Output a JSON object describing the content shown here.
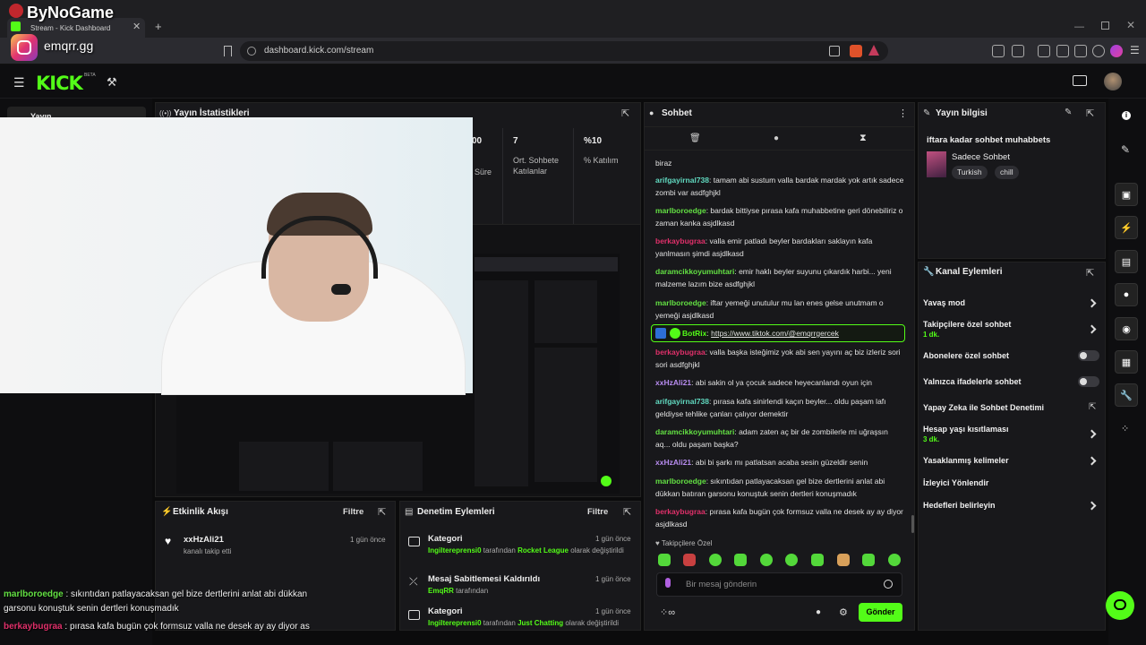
{
  "overlay": {
    "brand": "ByNoGame",
    "instagram": "emqrr.gg"
  },
  "browser": {
    "tab_title": "Stream - Kick Dashboard",
    "url": "dashboard.kick.com/stream"
  },
  "kick": {
    "logo": "KICK",
    "beta": "BETA"
  },
  "sidebar": {
    "label": "Yayın"
  },
  "stats": {
    "title": "Yayın İstatistikleri",
    "items": [
      {
        "value": "00",
        "label": "Süre"
      },
      {
        "value": "7",
        "label": "Ort. Sohbete Katılanlar"
      },
      {
        "value": "%10",
        "label": "% Katılım"
      }
    ]
  },
  "chat": {
    "title": "Sohbet",
    "messages": [
      {
        "user": "",
        "text": "biraz",
        "color": "#e2e2e2"
      },
      {
        "user": "arifgayirnal738",
        "text": "tamam abi sustum valla bardak mardak yok artık sadece zombi var asdfghjkl",
        "color": "#61d9c0"
      },
      {
        "user": "marlboroedge",
        "text": "bardak bittiyse pırasa kafa muhabbetine geri dönebiliriz o zaman kanka asjdlkasd",
        "color": "#63e043"
      },
      {
        "user": "berkaybugraa",
        "text": "valla emir patladı beyler bardakları saklayın kafa yanlmasın şimdi asjdlkasd",
        "color": "#e0306a"
      },
      {
        "user": "daramcikkoyumuhtari",
        "text": "emir haklı beyler suyunu çıkardık harbi... yeni malzeme lazım bize asdfghjkl",
        "color": "#63e043"
      },
      {
        "user": "marlboroedge",
        "text": "iftar yemeği unutulur mu lan enes gelse unutmam o yemeği asjdlkasd",
        "color": "#63e043"
      },
      {
        "user": "BotRix",
        "text": "https://www.tiktok.com/@emqrrgercek",
        "color": "#53fc18"
      },
      {
        "user": "berkaybugraa",
        "text": "valla başka isteğimiz yok abi sen yayını aç biz izleriz sori sori asdfghjkl",
        "color": "#e0306a"
      },
      {
        "user": "xxHzAli21",
        "text": "abi sakin ol ya çocuk sadece heyecanlandı oyun için",
        "color": "#b88cf0"
      },
      {
        "user": "arifgayirnal738",
        "text": "pırasa kafa sinirlendi kaçın beyler... oldu paşam lafı geldiyse tehlike çanları çalıyor demektir",
        "color": "#61d9c0"
      },
      {
        "user": "daramcikkoyumuhtari",
        "text": "adam zaten aç bir de zombilerle mi uğraşsın aq... oldu paşam başka?",
        "color": "#63e043"
      },
      {
        "user": "xxHzAli21",
        "text": "abi bi şarkı mı patlatsan acaba sesin güzeldir senin",
        "color": "#b88cf0"
      },
      {
        "user": "marlboroedge",
        "text": "sıkıntıdan patlayacaksan gel bize dertlerini anlat abi dükkan batıran garsonu konuştuk senin dertleri konuşmadık",
        "color": "#63e043"
      },
      {
        "user": "berkaybugraa",
        "text": "pırasa kafa bugün çok formsuz valla ne desek ay ay diyor asjdlkasd",
        "color": "#e0306a"
      }
    ],
    "followers_only": "Takipçilere Özel",
    "input_placeholder": "Bir mesaj gönderin",
    "send": "Gönder"
  },
  "stream_info": {
    "title": "Yayın bilgisi",
    "stream_title": "iftara kadar sohbet muhabbets",
    "category": "Sadece Sohbet",
    "tags": [
      "Turkish",
      "chill"
    ]
  },
  "channel_actions": {
    "title": "Kanal Eylemleri",
    "items": [
      {
        "label": "Yavaş mod",
        "sub": "",
        "control": "chevron"
      },
      {
        "label": "Takipçilere özel sohbet",
        "sub": "1 dk.",
        "control": "chevron"
      },
      {
        "label": "Abonelere özel sohbet",
        "sub": "",
        "control": "toggle"
      },
      {
        "label": "Yalnızca ifadelerle sohbet",
        "sub": "",
        "control": "toggle"
      },
      {
        "label": "Yapay Zeka ile Sohbet Denetimi",
        "sub": "",
        "control": "external"
      },
      {
        "label": "Hesap yaşı kısıtlaması",
        "sub": "3 dk.",
        "control": "chevron"
      },
      {
        "label": "Yasaklanmış kelimeler",
        "sub": "",
        "control": "chevron"
      },
      {
        "label": "İzleyici Yönlendir",
        "sub": "",
        "control": "none"
      },
      {
        "label": "Hedefleri belirleyin",
        "sub": "",
        "control": "chevron"
      }
    ]
  },
  "activity": {
    "title": "Etkinlik Akışı",
    "filter": "Filtre",
    "items": [
      {
        "user": "xxHzAli21",
        "text": "kanalı takip etti",
        "time": "1 gün önce"
      }
    ]
  },
  "moderation": {
    "title": "Denetim Eylemleri",
    "filter": "Filtre",
    "items": [
      {
        "title": "Kategori",
        "actor": "Ingiltereprensi0",
        "mid": " tarafından ",
        "target": "Rocket League",
        "tail": " olarak değiştirildi",
        "time": "1 gün önce"
      },
      {
        "title": "Mesaj Sabitlemesi Kaldırıldı",
        "actor": "EmqRR",
        "mid": " tarafından",
        "target": "",
        "tail": "",
        "time": "1 gün önce"
      },
      {
        "title": "Kategori",
        "actor": "Ingiltereprensi0",
        "mid": " tarafından ",
        "target": "Just Chatting",
        "tail": " olarak değiştirildi",
        "time": "1 gün önce"
      }
    ]
  },
  "overlay_chat": [
    {
      "user": "marlboroedge",
      "sep": " : ",
      "text": "sıkıntıdan patlayacaksan gel bize dertlerini anlat abi dükkan",
      "line2": "garsonu konuştuk senin dertleri konuşmadık",
      "color": "#63e043"
    },
    {
      "user": "berkaybugraa",
      "sep": " : ",
      "text": "pırasa kafa bugün çok formsuz valla ne desek ay ay diyor as",
      "line2": "",
      "color": "#e0306a"
    }
  ]
}
